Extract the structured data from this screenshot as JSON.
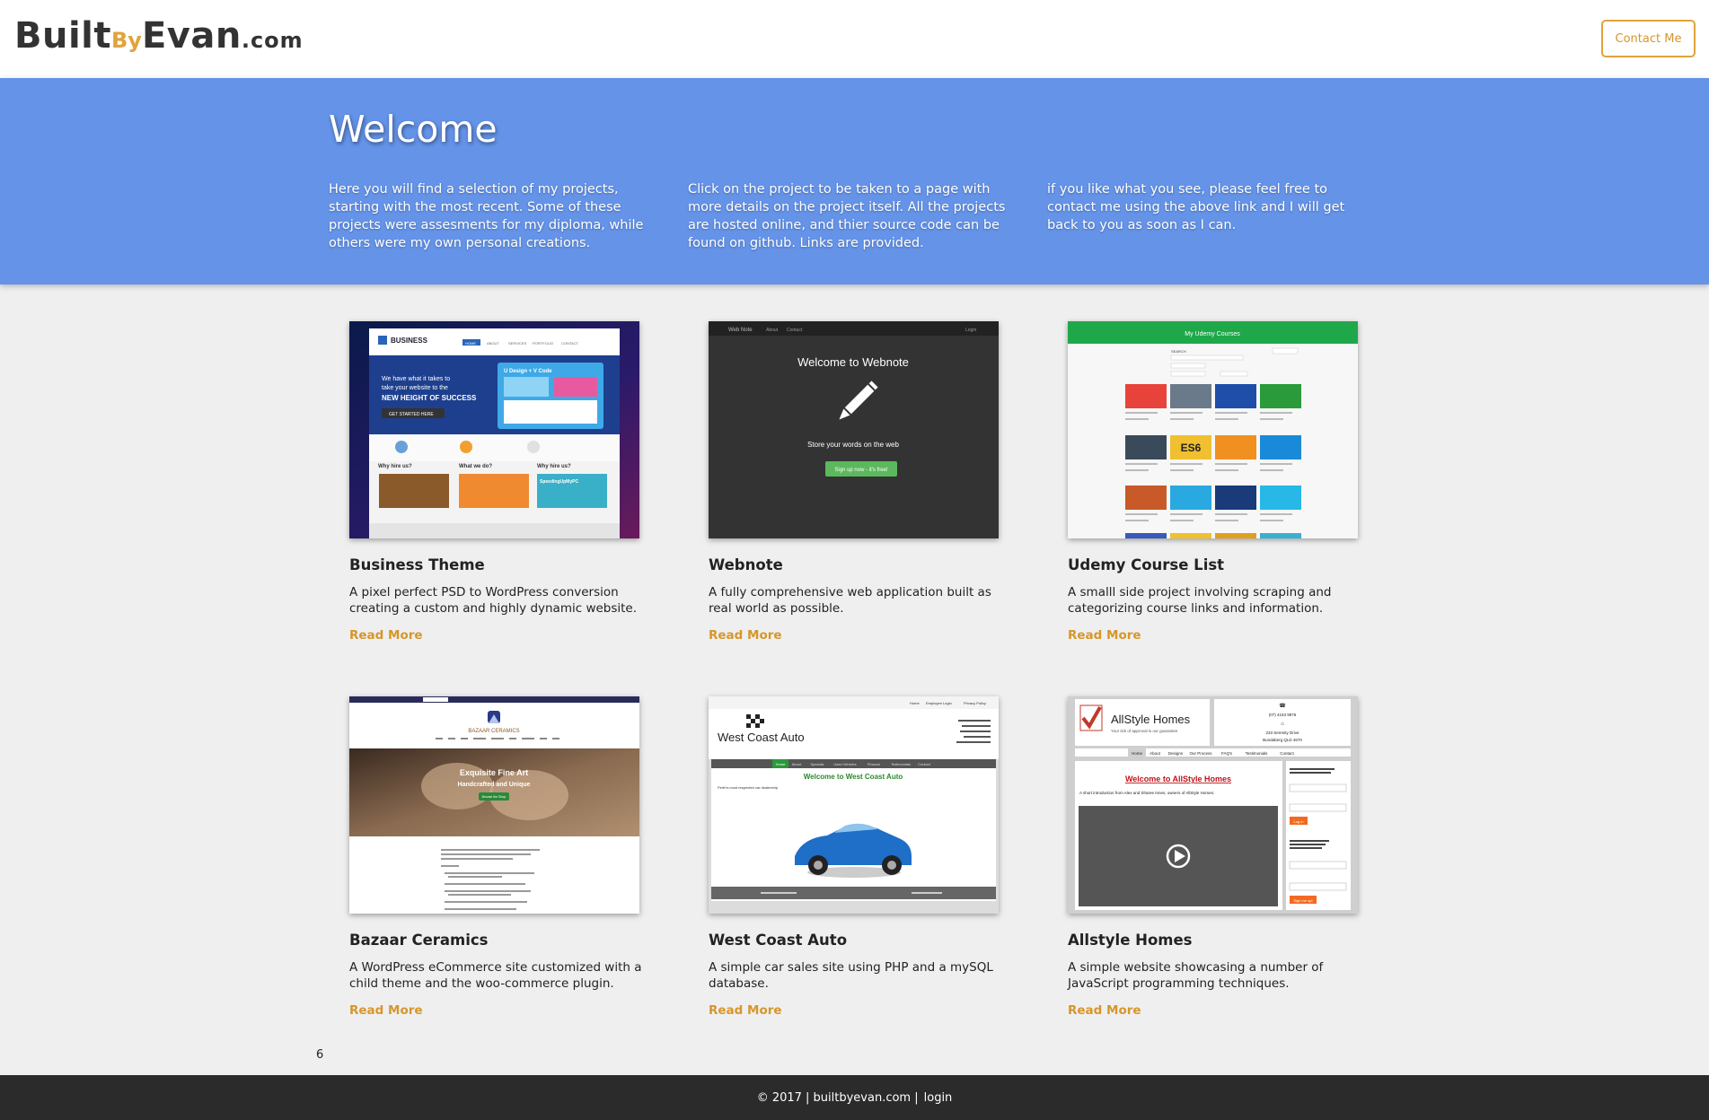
{
  "header": {
    "logo": {
      "part1": "Built",
      "part2": "By",
      "part3": "Evan",
      "part4": ".com"
    },
    "contact_label": "Contact Me"
  },
  "banner": {
    "title": "Welcome",
    "columns": [
      "Here you will find a selection of my projects, starting with the most recent. Some of these projects were assesments for my diploma, while others were my own personal creations.",
      "Click on the project to be taken to a page with more details on the project itself. All the projects are hosted online, and thier source code can be found on github. Links are provided.",
      "if you like what you see, please feel free to contact me using the above link and I will get back to you as soon as I can."
    ]
  },
  "projects": [
    {
      "title": "Business Theme",
      "desc": "A pixel perfect PSD to WordPress conversion creating a custom and highly dynamic website.",
      "link": "Read More",
      "thumb": {
        "brand": "BUSINESS",
        "nav": [
          "HOME",
          "ABOUT",
          "SERVICES",
          "PORTFOLIO",
          "CONTACT"
        ],
        "hero_lines": [
          "We have what it takes to",
          "take your website to the",
          "NEW HEIGHT OF SUCCESS"
        ],
        "cta": "GET STARTED HERE",
        "panel": "U Design + V Code",
        "cols": [
          "Why hire us?",
          "What we do?",
          "Why hire us?"
        ],
        "speeding": "SpeedingUpMyPC"
      }
    },
    {
      "title": "Webnote",
      "desc": "A fully comprehensive web application built as real world as possible.",
      "link": "Read More",
      "thumb": {
        "brand": "Web Note",
        "nav": [
          "About",
          "Contact"
        ],
        "login": "Login",
        "headline": "Welcome to Webnote",
        "tagline": "Store your words on the web",
        "cta": "Sign up now - it's free!"
      }
    },
    {
      "title": "Udemy Course List",
      "desc": "A smalll side project involving scraping and categorizing course links and information.",
      "link": "Read More",
      "thumb": {
        "header": "My Udemy Courses",
        "search": "SEARCH",
        "tile_label": "ES6"
      }
    },
    {
      "title": "Bazaar Ceramics",
      "desc": "A WordPress eCommerce site customized with a child theme and the woo-commerce plugin.",
      "link": "Read More",
      "thumb": {
        "brand": "BAZAAR CERAMICS",
        "hero_title": "Exquisite Fine Art",
        "hero_sub": "Handcrafted and Unique",
        "cta": "Browse the Shop"
      }
    },
    {
      "title": "West Coast Auto",
      "desc": "A simple car sales site using PHP and a mySQL database.",
      "link": "Read More",
      "thumb": {
        "top_links": [
          "Home",
          "Employee Login",
          "Privacy Policy"
        ],
        "brand": "West Coast Auto",
        "nav": [
          "Home",
          "About",
          "Specials",
          "Used Vehicles",
          "Finance",
          "Testimonials",
          "Contact"
        ],
        "headline": "Welcome to West Coast Auto",
        "tagline": "Perth's most respected car dealership"
      }
    },
    {
      "title": "Allstyle Homes",
      "desc": "A simple website showcasing a number of JavaScript programming techniques.",
      "link": "Read More",
      "thumb": {
        "brand": "AllStyle Homes",
        "tagline": "Your tick of approval is our guarantee",
        "phone": "(07) 4153 9876",
        "address": "233 Serenity Drive",
        "city": "Bundaberg QLD 4670",
        "nav": [
          "Home",
          "About",
          "Designs",
          "Our Process",
          "FAQ's",
          "Testimonials",
          "Contact"
        ],
        "headline": "Welcome to AllStyle Homes",
        "intro": "A short introduction from Alex and Sharee Innes, owners of AllStyle Homes:",
        "login_btn": "Log in",
        "signup_btn": "Sign me up!"
      }
    }
  ],
  "page_number": "6",
  "footer": {
    "copyright": "© 2017 | builtbyevan.com |",
    "login": "login"
  }
}
